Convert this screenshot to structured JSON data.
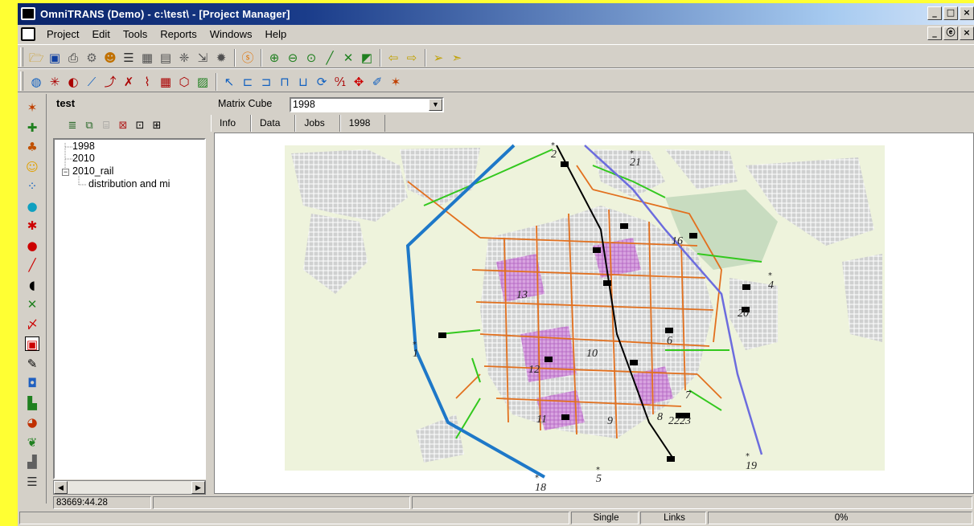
{
  "window": {
    "title": "OmniTRANS (Demo) - c:\\test\\ - [Project Manager]",
    "controls": {
      "minimize": "_",
      "maximize": "□",
      "close": "×"
    },
    "mdi_controls": {
      "minimize": "_",
      "restore": "ⓔ",
      "close": "×"
    }
  },
  "menu": [
    "Project",
    "Edit",
    "Tools",
    "Reports",
    "Windows",
    "Help"
  ],
  "toolbar1_icons": [
    "open-folder",
    "save",
    "print",
    "settings",
    "user",
    "list",
    "table",
    "calculator",
    "network",
    "export",
    "gear",
    "info",
    "zoom-in",
    "zoom-out",
    "zoom-area",
    "draw-line",
    "cross",
    "overview",
    "back",
    "forward",
    "select-arrow",
    "pointer"
  ],
  "toolbar2_icons": [
    "globe",
    "node",
    "centroid",
    "link",
    "route",
    "cross-tool",
    "line-tool",
    "grid",
    "polygon",
    "map-tool",
    "select",
    "box-select",
    "box-select-plus",
    "box-select-minus",
    "box-select-cross",
    "rotate",
    "label",
    "move",
    "paint",
    "stop"
  ],
  "left_toolbar_icons": [
    "stop",
    "puzzle",
    "users",
    "face",
    "dots",
    "sphere",
    "star",
    "circle",
    "line",
    "bubble",
    "cross",
    "pen",
    "bus",
    "pencil",
    "palette",
    "bars",
    "pie",
    "feather",
    "chart",
    "list"
  ],
  "tree": {
    "title": "test",
    "items": [
      {
        "label": "1998",
        "level": 1,
        "expander": ""
      },
      {
        "label": "2010",
        "level": 1,
        "expander": ""
      },
      {
        "label": "2010_rail",
        "level": 1,
        "expander": "−"
      },
      {
        "label": "distribution and mi",
        "level": 2,
        "expander": ""
      }
    ],
    "scroll_left": "◀",
    "scroll_right": "▶"
  },
  "matrix": {
    "label": "Matrix Cube",
    "value": "1998",
    "arrow": "▼"
  },
  "tabs": [
    "Info",
    "Data",
    "Jobs",
    "1998"
  ],
  "active_tab": "1998",
  "map": {
    "zones": [
      "2",
      "21",
      "16",
      "4",
      "13",
      "20",
      "6",
      "1",
      "10",
      "12",
      "7",
      "8",
      "22",
      "23",
      "11",
      "9",
      "19",
      "5",
      "18"
    ],
    "colors": {
      "background": "#eef3dc",
      "orange_network": "#e2701e",
      "green_rail": "#33c81e",
      "blue_rail": "#1e78c8",
      "purple_rail": "#6c6cde",
      "black_rail": "#000000",
      "urban": "#cfd0d0",
      "urban_dense": "#b0b2b2",
      "residential": "#d8a4e0"
    }
  },
  "status": {
    "coords": "83669:44.28",
    "mode": "Single",
    "selection": "Links",
    "progress": "0%"
  }
}
